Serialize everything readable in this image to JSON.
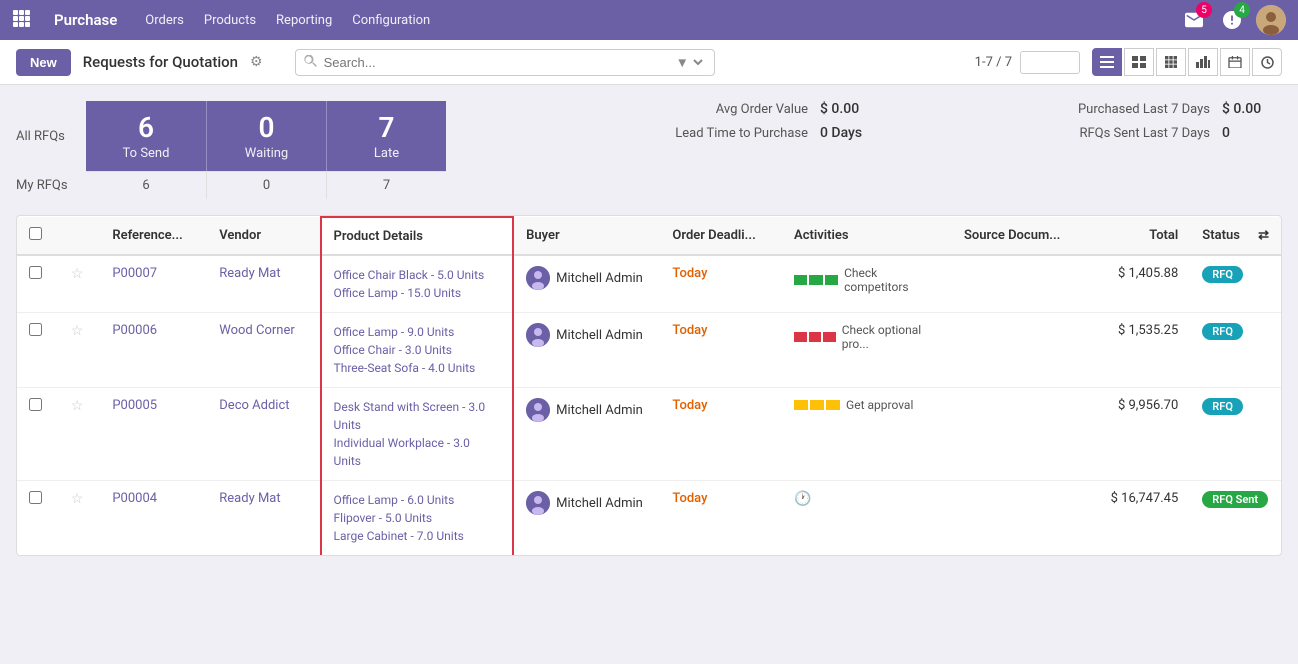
{
  "nav": {
    "app_name": "Purchase",
    "items": [
      "Orders",
      "Products",
      "Reporting",
      "Configuration"
    ],
    "notifications_count": "5",
    "updates_count": "4"
  },
  "subheader": {
    "new_label": "New",
    "title": "Requests for Quotation",
    "pagination": "1-7 / 7",
    "search_placeholder": "Search..."
  },
  "stats": {
    "all_rfqs_label": "All RFQs",
    "my_rfqs_label": "My RFQs",
    "cards": [
      {
        "num": "6",
        "name": "To Send",
        "my_val": "6"
      },
      {
        "num": "0",
        "name": "Waiting",
        "my_val": "0"
      },
      {
        "num": "7",
        "name": "Late",
        "my_val": "7"
      }
    ],
    "kpis": [
      {
        "label": "Avg Order Value",
        "value": "$ 0.00"
      },
      {
        "label": "Purchased Last 7 Days",
        "value": "$ 0.00"
      },
      {
        "label": "Lead Time to Purchase",
        "value": "0 Days"
      },
      {
        "label": "RFQs Sent Last 7 Days",
        "value": "0"
      }
    ]
  },
  "table": {
    "columns": [
      "Reference...",
      "Vendor",
      "Product Details",
      "Buyer",
      "Order Deadli...",
      "Activities",
      "Source Docum...",
      "Total",
      "Status"
    ],
    "rows": [
      {
        "ref": "P00007",
        "vendor": "Ready Mat",
        "products": [
          "Office Chair Black - 5.0 Units",
          "Office Lamp - 15.0 Units"
        ],
        "buyer": "Mitchell Admin",
        "deadline": "Today",
        "activity_color": "green",
        "activity_label": "Check competitors",
        "source": "",
        "total": "$ 1,405.88",
        "status": "RFQ",
        "status_type": "rfq",
        "is_last_product": false
      },
      {
        "ref": "P00006",
        "vendor": "Wood Corner",
        "products": [
          "Office Lamp - 9.0 Units",
          "Office Chair - 3.0 Units",
          "Three-Seat Sofa - 4.0 Units"
        ],
        "buyer": "Mitchell Admin",
        "deadline": "Today",
        "activity_color": "red",
        "activity_label": "Check optional pro...",
        "source": "",
        "total": "$ 1,535.25",
        "status": "RFQ",
        "status_type": "rfq",
        "is_last_product": false
      },
      {
        "ref": "P00005",
        "vendor": "Deco Addict",
        "products": [
          "Desk Stand with Screen - 3.0 Units",
          "Individual Workplace - 3.0 Units"
        ],
        "buyer": "Mitchell Admin",
        "deadline": "Today",
        "activity_color": "yellow",
        "activity_label": "Get approval",
        "source": "",
        "total": "$ 9,956.70",
        "status": "RFQ",
        "status_type": "rfq",
        "is_last_product": false
      },
      {
        "ref": "P00004",
        "vendor": "Ready Mat",
        "products": [
          "Office Lamp - 6.0 Units",
          "Flipover - 5.0 Units",
          "Large Cabinet - 7.0 Units"
        ],
        "buyer": "Mitchell Admin",
        "deadline": "Today",
        "activity_color": "none",
        "activity_label": "",
        "source": "",
        "total": "$ 16,747.45",
        "status": "RFQ Sent",
        "status_type": "rfq-sent",
        "is_last_product": true
      }
    ]
  }
}
